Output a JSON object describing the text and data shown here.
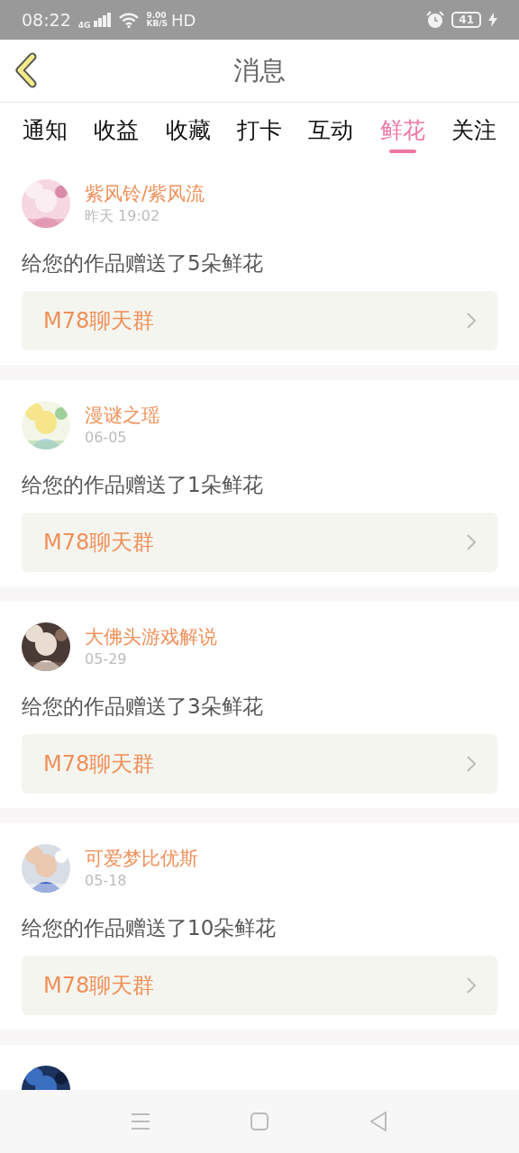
{
  "status_bar": {
    "time": "08:22",
    "network": "4G",
    "speed_value": "9.00",
    "speed_unit": "KB/S",
    "quality": "HD",
    "battery": "41",
    "charging": true
  },
  "header": {
    "title": "消息"
  },
  "tabs": [
    {
      "label": "通知",
      "selected": false
    },
    {
      "label": "收益",
      "selected": false
    },
    {
      "label": "收藏",
      "selected": false
    },
    {
      "label": "打卡",
      "selected": false
    },
    {
      "label": "互动",
      "selected": false
    },
    {
      "label": "鲜花",
      "selected": true
    },
    {
      "label": "关注",
      "selected": false
    }
  ],
  "messages": [
    {
      "sender": "紫风铃/紫风流",
      "time": "昨天 19:02",
      "text": "给您的作品赠送了5朵鲜花",
      "group": "M78聊天群"
    },
    {
      "sender": "漫谜之瑶",
      "time": "06-05",
      "text": "给您的作品赠送了1朵鲜花",
      "group": "M78聊天群"
    },
    {
      "sender": "大佛头游戏解说",
      "time": "05-29",
      "text": "给您的作品赠送了3朵鲜花",
      "group": "M78聊天群"
    },
    {
      "sender": "可爱梦比优斯",
      "time": "05-18",
      "text": "给您的作品赠送了10朵鲜花",
      "group": "M78聊天群"
    },
    {
      "kind": "partial"
    }
  ]
}
